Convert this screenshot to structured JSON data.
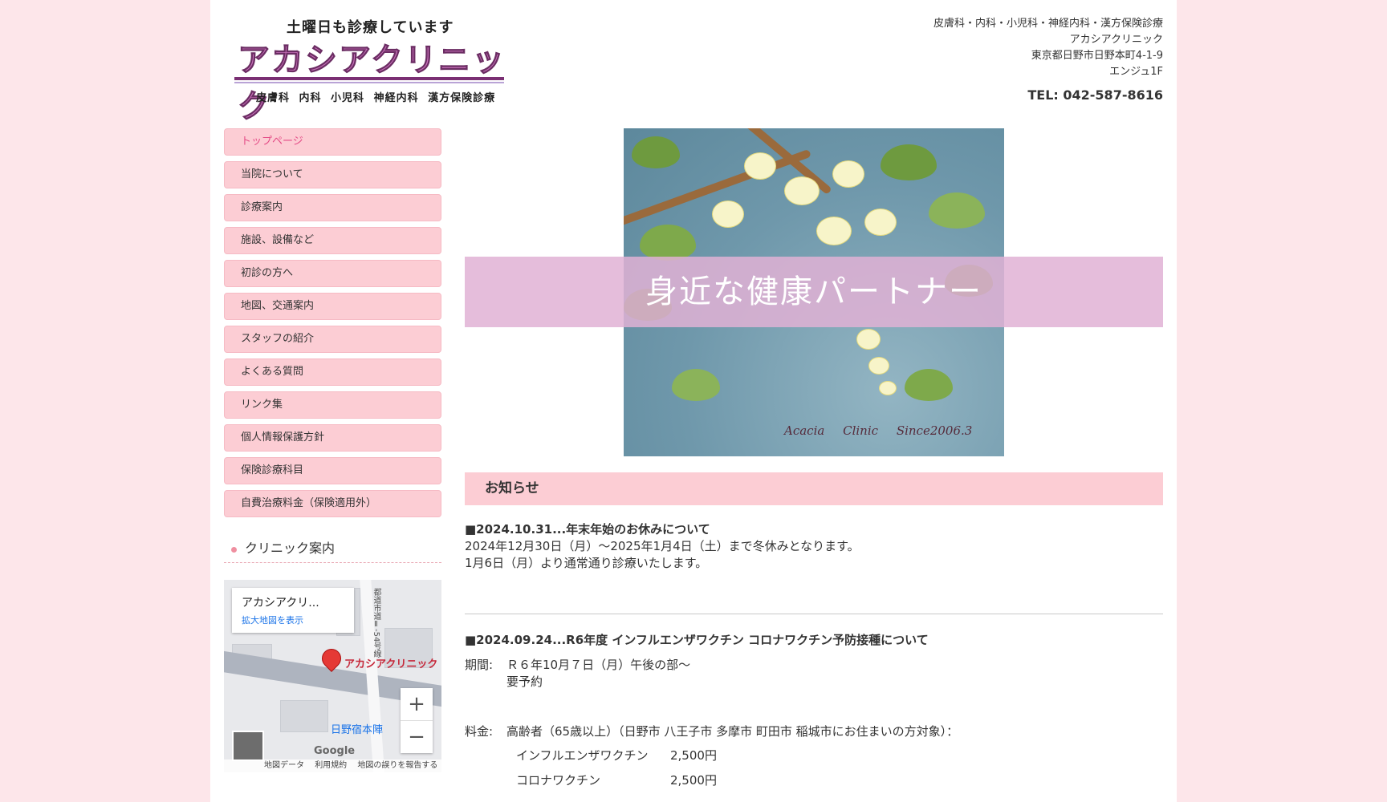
{
  "header": {
    "tagline": "土曜日も診療しています",
    "clinic_logo_name": "アカシアクリニック",
    "logo_departments": "皮膚科 内科 小児科 神経内科 漢方保険診療",
    "info_lines": [
      "皮膚科・内科・小児科・神経内科・漢方保険診療",
      "アカシアクリニック",
      "東京都日野市日野本町4-1-9",
      "エンジュ1F"
    ],
    "tel": "TEL: 042-587-8616"
  },
  "nav": {
    "items": [
      {
        "label": "トップページ"
      },
      {
        "label": "当院について"
      },
      {
        "label": "診療案内"
      },
      {
        "label": "施設、設備など"
      },
      {
        "label": "初診の方へ"
      },
      {
        "label": "地図、交通案内"
      },
      {
        "label": "スタッフの紹介"
      },
      {
        "label": "よくある質問"
      },
      {
        "label": "リンク集"
      },
      {
        "label": "個人情報保護方針"
      },
      {
        "label": "保険診療科目"
      },
      {
        "label": "自費治療料金（保険適用外）"
      }
    ]
  },
  "side": {
    "clinic_heading": "クリニック案内"
  },
  "map": {
    "card_title": "アカシアクリ...",
    "card_link": "拡大地図を表示",
    "pin_label": "アカシアクリニック",
    "station_label": "日野宿本陣",
    "road_label": "都道市道Ⅱ-54号線",
    "zoom_in": "+",
    "zoom_out": "−",
    "google_logo": "Google",
    "footer_data": "地図データ",
    "footer_terms": "利用規約",
    "footer_report": "地図の誤りを報告する"
  },
  "hero": {
    "headline": "身近な健康パートナー",
    "signature_left": "Acacia Clinic",
    "signature_right": "Since2006.3"
  },
  "news": {
    "section_title": "お知らせ",
    "item1": {
      "heading": "■2024.10.31...年末年始のお休みについて",
      "line1": "2024年12月30日（月）～2025年1月4日（土）まで冬休みとなります。",
      "line2": "1月6日（月）より通常通り診療いたします。"
    },
    "item2": {
      "heading": "■2024.09.24...R6年度 インフルエンザワクチン コロナワクチン予防接種について",
      "period_label": "期間:",
      "period_value": "Ｒ６年10月７日（月）午後の部～",
      "period_note": "要予約",
      "fee_label": "料金:",
      "fee_value": "高齢者（65歳以上）（日野市 八王子市 多摩市 町田市 稲城市にお住まいの方対象）：",
      "prices": [
        {
          "name": "インフルエンザワクチン",
          "price": "2,500円"
        },
        {
          "name": "コロナワクチン",
          "price": "2,500円"
        }
      ]
    }
  }
}
